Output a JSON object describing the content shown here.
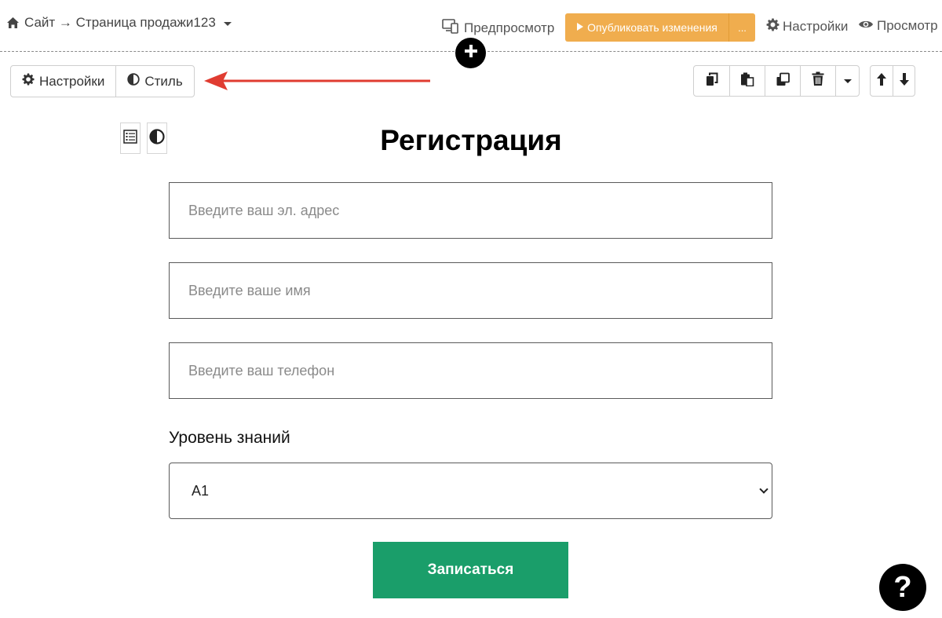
{
  "topbar": {
    "breadcrumb": "Сайт → Страница продажи123",
    "preview_label": "Предпросмотр",
    "publish_label": "Опубликовать изменения",
    "publish_more_label": "...",
    "settings_label": "Настройки",
    "view_label": "Просмотр"
  },
  "block_toolbar": {
    "settings_tab": "Настройки",
    "style_tab": "Стиль"
  },
  "form": {
    "title": "Регистрация",
    "email_placeholder": "Введите ваш эл. адрес",
    "name_placeholder": "Введите ваше имя",
    "phone_placeholder": "Введите ваш телефон",
    "level_label": "Уровень знаний",
    "level_value": "A1",
    "submit_label": "Записаться"
  },
  "help": {
    "label": "?"
  },
  "colors": {
    "publish": "#f0ad4e",
    "submit": "#1a9e6a",
    "annotation_arrow": "#e03c31"
  },
  "icons": [
    "home-icon",
    "devices-icon",
    "play-icon",
    "gear-icon",
    "eye-icon",
    "plus-icon",
    "half-circle-icon",
    "copy-icon",
    "paste-icon",
    "duplicate-icon",
    "trash-icon",
    "arrow-up-icon",
    "arrow-down-icon",
    "form-list-icon"
  ]
}
